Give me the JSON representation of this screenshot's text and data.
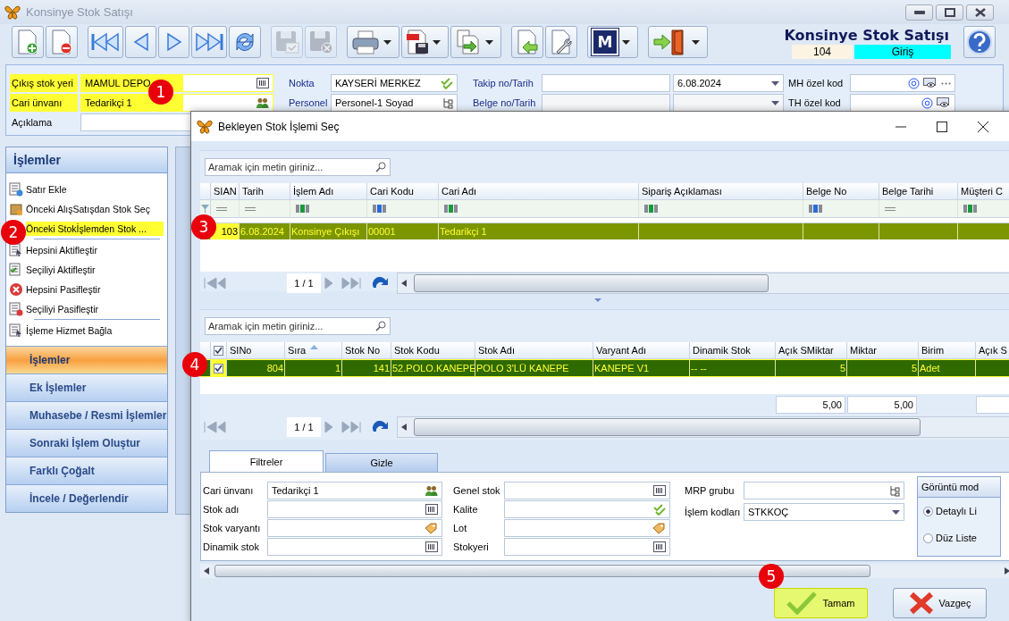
{
  "window": {
    "title": "Konsinye Stok Satışı"
  },
  "toolbar": [
    {
      "kind": "new",
      "disabled": false,
      "dropdown": false
    },
    {
      "kind": "delete",
      "disabled": false,
      "dropdown": false
    },
    {
      "kind": "first",
      "disabled": false,
      "dropdown": false
    },
    {
      "kind": "prev",
      "disabled": false,
      "dropdown": false
    },
    {
      "kind": "next",
      "disabled": false,
      "dropdown": false
    },
    {
      "kind": "last",
      "disabled": false,
      "dropdown": false
    },
    {
      "kind": "refresh",
      "disabled": false,
      "dropdown": false
    },
    {
      "kind": "save",
      "disabled": true,
      "dropdown": false
    },
    {
      "kind": "discard",
      "disabled": true,
      "dropdown": false
    },
    {
      "kind": "print",
      "disabled": false,
      "dropdown": true
    },
    {
      "kind": "pdf",
      "disabled": false,
      "dropdown": true
    },
    {
      "kind": "copy",
      "disabled": false,
      "dropdown": true
    },
    {
      "kind": "import",
      "disabled": false,
      "dropdown": false
    },
    {
      "kind": "settings",
      "disabled": false,
      "dropdown": false
    },
    {
      "kind": "logo",
      "label": "M",
      "disabled": false,
      "dropdown": true
    },
    {
      "kind": "exit",
      "disabled": false,
      "dropdown": true
    }
  ],
  "header": {
    "title": "Konsinye Stok Satışı",
    "number": "104",
    "mode": "Giriş"
  },
  "form": {
    "stock_location": {
      "label": "Çıkış stok yeri",
      "value": "MAMUL DEPO",
      "highlighted": true
    },
    "account": {
      "label": "Cari ünvanı",
      "value": "Tedarikçi 1",
      "highlighted": true
    },
    "description": {
      "label": "Açıklama"
    },
    "point": {
      "label": "Nokta",
      "value": "KAYSERİ MERKEZ"
    },
    "staff": {
      "label": "Personel",
      "value": "Personel-1 Soyad"
    },
    "tracking": {
      "label": "Takip no/Tarih",
      "date": "6.08.2024"
    },
    "document": {
      "label": "Belge no/Tarih"
    },
    "mh_code": {
      "label": "MH özel kod"
    },
    "th_code": {
      "label": "TH özel kod"
    }
  },
  "sidebar": {
    "title": "İşlemler",
    "items": [
      {
        "label": "Satır Ekle",
        "highlighted": false
      },
      {
        "label": "Önceki AlışSatışdan Stok Seç",
        "highlighted": false
      },
      {
        "label": "Önceki Stokİşlemden Stok ...",
        "highlighted": true
      },
      {
        "label": "Hepsini Aktifleştir",
        "highlighted": false
      },
      {
        "label": "Seçiliyi Aktifleştir",
        "highlighted": false
      },
      {
        "label": "Hepsini Pasifleştir",
        "highlighted": false
      },
      {
        "label": "Seçiliyi Pasifleştir",
        "highlighted": false
      },
      {
        "label": "İşleme Hizmet Bağla",
        "highlighted": false
      }
    ],
    "groups": [
      {
        "label": "İşlemler",
        "selected": true
      },
      {
        "label": "Ek İşlemler",
        "selected": false
      },
      {
        "label": "Muhasebe / Resmi İşlemler",
        "selected": false
      },
      {
        "label": "Sonraki İşlem Oluştur",
        "selected": false
      },
      {
        "label": "Farklı Çoğalt",
        "selected": false
      },
      {
        "label": "İncele / Değerlendir",
        "selected": false
      }
    ]
  },
  "dialog": {
    "title": "Bekleyen Stok İşlemi Seç",
    "pending_grid": {
      "search": {
        "placeholder": "Aramak için metin giriniz..."
      },
      "columns": [
        {
          "label": "SIAN",
          "kind": "equals"
        },
        {
          "label": "Tarih",
          "kind": "equals"
        },
        {
          "label": "İşlem Adı",
          "kind": "contains"
        },
        {
          "label": "Cari Kodu",
          "kind": "begins"
        },
        {
          "label": "Cari Adı",
          "kind": "contains"
        },
        {
          "label": "Sipariş Açıklaması",
          "kind": "contains"
        },
        {
          "label": "Belge No",
          "kind": "begins"
        },
        {
          "label": "Belge Tarihi",
          "kind": "equals"
        },
        {
          "label": "Müşteri C",
          "kind": "contains"
        }
      ],
      "rows": [
        {
          "selected": true,
          "cells": [
            "103",
            "6.08.2024",
            "Konsinye Çıkışı",
            "00001",
            "Tedarikçi 1"
          ]
        }
      ],
      "pager": "1 / 1"
    },
    "lines_grid": {
      "search": {
        "placeholder": "Aramak için metin giriniz..."
      },
      "all_checked": true,
      "columns": [
        {
          "label": "SINo",
          "sorted": false,
          "summed": false
        },
        {
          "label": "Sıra",
          "sorted": true,
          "summed": false
        },
        {
          "label": "Stok No",
          "sorted": false,
          "summed": false
        },
        {
          "label": "Stok Kodu",
          "sorted": false,
          "summed": false
        },
        {
          "label": "Stok Adı",
          "sorted": false,
          "summed": false
        },
        {
          "label": "Varyant Adı",
          "sorted": false,
          "summed": false
        },
        {
          "label": "Dinamik Stok",
          "sorted": false,
          "summed": false
        },
        {
          "label": "Açık SMiktar",
          "sorted": false,
          "summed": true,
          "total": "5,00"
        },
        {
          "label": "Miktar",
          "sorted": false,
          "summed": true,
          "total": "5,00"
        },
        {
          "label": "Birim",
          "sorted": false,
          "summed": false
        },
        {
          "label": "Açık S",
          "sorted": false,
          "summed": true
        }
      ],
      "rows": [
        {
          "checked": true,
          "selected": true,
          "cells": [
            "804",
            "1",
            "141",
            "52.POLO.KANEPE",
            "POLO 3'LÜ KANEPE",
            "KANEPE V1",
            "-- --",
            "5",
            "5",
            "Adet"
          ]
        }
      ],
      "pager": "1 / 1"
    },
    "tabs": [
      {
        "label": "Filtreler",
        "selected": true
      },
      {
        "label": "Gizle",
        "selected": false
      }
    ],
    "filters": [
      [
        {
          "label": "Cari ünvanı",
          "value": "Tedarikçi 1",
          "kind": "people"
        },
        {
          "label": "Stok adı",
          "kind": "list"
        },
        {
          "label": "Stok varyantı",
          "kind": "tag"
        },
        {
          "label": "Dinamik stok",
          "kind": "list"
        }
      ],
      [
        {
          "label": "Genel stok",
          "kind": "list"
        },
        {
          "label": "Kalite",
          "kind": "check"
        },
        {
          "label": "Lot",
          "kind": "tag"
        },
        {
          "label": "Stokyeri",
          "kind": "list"
        }
      ],
      [
        {
          "label": "MRP grubu",
          "kind": "tree"
        },
        {
          "label": "İşlem kodları",
          "value": "STKKOÇ",
          "kind": "dropdown"
        }
      ]
    ],
    "view_mode": {
      "title": "Görüntü mod",
      "options": [
        {
          "label": "Detaylı Li",
          "selected": true
        },
        {
          "label": "Düz Liste",
          "selected": false
        }
      ]
    },
    "buttons": [
      {
        "label": "Tamam",
        "kind": "ok",
        "highlighted": true
      },
      {
        "label": "Vazgeç",
        "kind": "cancel",
        "highlighted": false
      }
    ]
  },
  "callouts": [
    {
      "label": "1"
    },
    {
      "label": "2"
    },
    {
      "label": "3"
    },
    {
      "label": "4"
    },
    {
      "label": "5"
    }
  ]
}
